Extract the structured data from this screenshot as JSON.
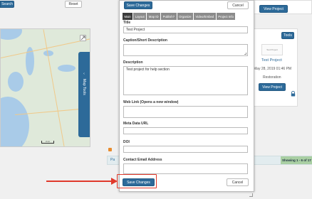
{
  "background": {
    "search_label": "Search",
    "reset_label": "Reset",
    "map": {
      "tab_label": "Map Tools",
      "scale_label": "2 mi"
    },
    "project_card_top": {
      "view_label": "View Project"
    },
    "project_card": {
      "tools_label": "Tools",
      "thumbnail_text": "Test Project",
      "title": "Test Project",
      "date": "May 28, 2019 01:46 PM",
      "category": "Restoration",
      "view_label": "View Project"
    },
    "pagination_fragment": "Pa",
    "showing_text": "Showing 1 - 6 of 17"
  },
  "modal": {
    "top_save_label": "Save Changes",
    "top_cancel_label": "Cancel",
    "tabs": [
      {
        "label": "Main"
      },
      {
        "label": "Layout"
      },
      {
        "label": "Map ID"
      },
      {
        "label": "Publish?"
      },
      {
        "label": "Organize"
      },
      {
        "label": "Video/Embed"
      },
      {
        "label": "Project Info"
      }
    ],
    "fields": {
      "title_label": "Title",
      "title_value": "Test Project",
      "caption_label": "Caption/Short Description",
      "caption_value": "",
      "description_label": "Description",
      "description_value": "Test project for help section",
      "web_link_label": "Web Link (Opens a new window)",
      "web_link_value": "",
      "metadata_label": "Meta Data URL",
      "metadata_value": "",
      "doi_label": "DOI",
      "doi_value": "",
      "contact_label": "Contact Email Address",
      "contact_value": ""
    },
    "bottom_save_label": "Save Changes",
    "bottom_cancel_label": "Cancel"
  },
  "colors": {
    "primary": "#2d6a99",
    "tab_inactive": "#8b8b8b",
    "tab_active": "#3c3c3c",
    "callout": "#e0392b"
  },
  "icons": [
    "search-icon",
    "lock-icon",
    "rss-icon",
    "expand-icon",
    "arrow-left-icon",
    "resize-grip-icon"
  ]
}
